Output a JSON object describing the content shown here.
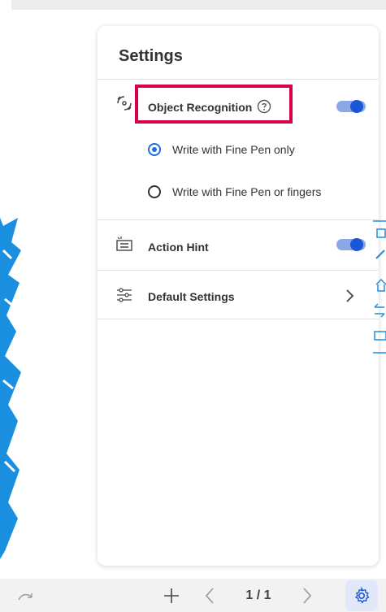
{
  "settings_panel": {
    "title": "Settings",
    "object_recognition": {
      "label": "Object Recognition",
      "help_icon": "help-circle-icon",
      "enabled": true,
      "options": [
        {
          "label": "Write with Fine Pen only",
          "selected": true
        },
        {
          "label": "Write with Fine Pen or fingers",
          "selected": false
        }
      ]
    },
    "action_hint": {
      "label": "Action Hint",
      "enabled": true
    },
    "default_settings": {
      "label": "Default Settings"
    }
  },
  "bottom_bar": {
    "redo_icon": "redo-icon",
    "add_icon": "plus-icon",
    "prev_icon": "chevron-left-icon",
    "page_indicator": "1 / 1",
    "next_icon": "chevron-right-icon",
    "settings_icon": "gear-icon"
  },
  "side_toolbar": {
    "icons": [
      "edit-icon",
      "pen-icon",
      "home-icon",
      "switch-icon",
      "pc-icon"
    ]
  },
  "colors": {
    "accent": "#1a57d6",
    "highlight_border": "#d6004f",
    "ink": "#1a8fe0"
  }
}
